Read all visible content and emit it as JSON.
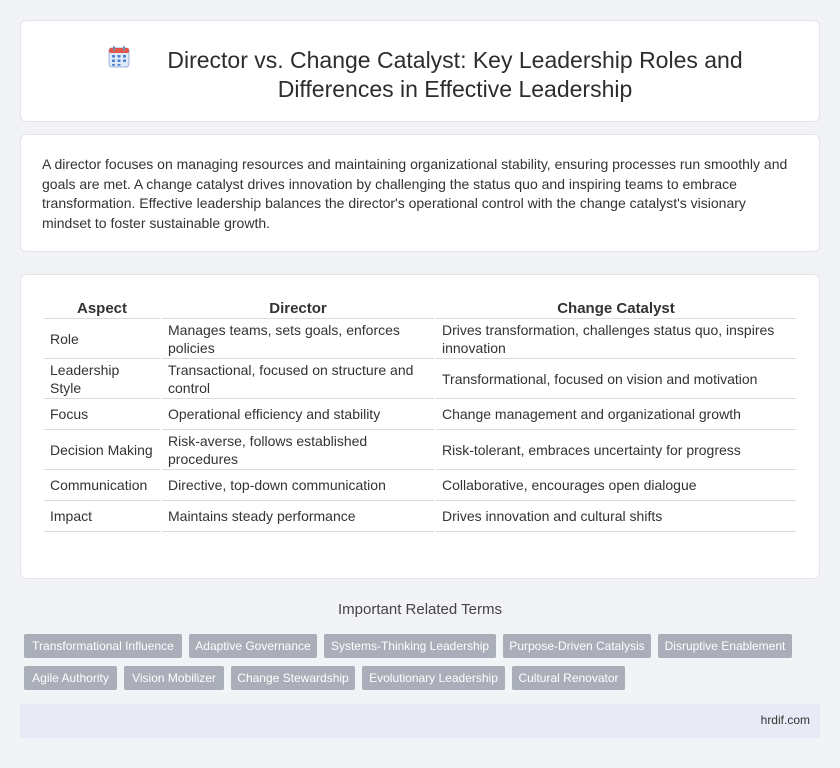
{
  "header": {
    "icon": "calendar-icon",
    "title": "Director vs. Change Catalyst: Key Leadership Roles and Differences in Effective Leadership"
  },
  "intro": {
    "text": "A director focuses on managing resources and maintaining organizational stability, ensuring processes run smoothly and goals are met. A change catalyst drives innovation by challenging the status quo and inspiring teams to embrace transformation. Effective leadership balances the director's operational control with the change catalyst's visionary mindset to foster sustainable growth."
  },
  "table": {
    "headers": [
      "Aspect",
      "Director",
      "Change Catalyst"
    ],
    "rows": [
      [
        "Role",
        "Manages teams, sets goals, enforces policies",
        "Drives transformation, challenges status quo, inspires innovation"
      ],
      [
        "Leadership Style",
        "Transactional, focused on structure and control",
        "Transformational, focused on vision and motivation"
      ],
      [
        "Focus",
        "Operational efficiency and stability",
        "Change management and organizational growth"
      ],
      [
        "Decision Making",
        "Risk-averse, follows established procedures",
        "Risk-tolerant, embraces uncertainty for progress"
      ],
      [
        "Communication",
        "Directive, top-down communication",
        "Collaborative, encourages open dialogue"
      ],
      [
        "Impact",
        "Maintains steady performance",
        "Drives innovation and cultural shifts"
      ]
    ]
  },
  "related": {
    "title": "Important Related Terms",
    "terms": [
      "Transformational Influence",
      "Adaptive Governance",
      "Systems-Thinking Leadership",
      "Purpose-Driven Catalysis",
      "Disruptive Enablement",
      "Agile Authority",
      "Vision Mobilizer",
      "Change Stewardship",
      "Evolutionary Leadership",
      "Cultural Renovator"
    ]
  },
  "footer": {
    "site": "hrdif.com"
  },
  "colors": {
    "tag_bg": "#a9aeb8",
    "footer_bg": "#e8ebf5",
    "icon_blue": "#4a7fd4",
    "icon_red": "#e2574c"
  }
}
